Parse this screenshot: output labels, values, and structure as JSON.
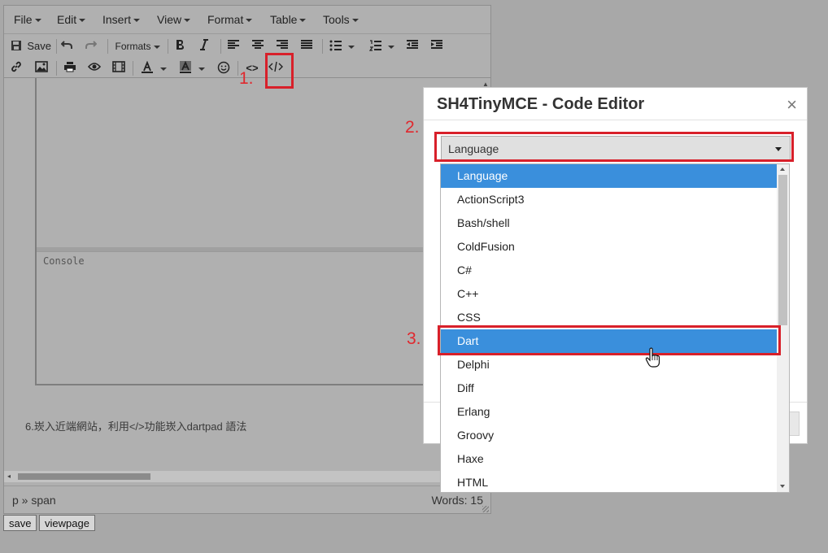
{
  "menubar": {
    "items": [
      {
        "label": "File"
      },
      {
        "label": "Edit"
      },
      {
        "label": "Insert"
      },
      {
        "label": "View"
      },
      {
        "label": "Format"
      },
      {
        "label": "Table"
      },
      {
        "label": "Tools"
      }
    ]
  },
  "toolbar": {
    "save_label": "Save",
    "formats_label": "Formats",
    "code_label": "<>",
    "icons": [
      "save-icon",
      "undo-icon",
      "redo-icon",
      "bold-icon",
      "italic-icon",
      "align-left-icon",
      "align-center-icon",
      "align-right-icon",
      "align-justify-icon",
      "bullet-list-icon",
      "numbered-list-icon",
      "outdent-icon",
      "indent-icon",
      "link-icon",
      "image-icon",
      "print-icon",
      "preview-icon",
      "media-icon",
      "text-color-icon",
      "background-color-icon",
      "emoticons-icon",
      "code-icon",
      "code-sample-icon"
    ]
  },
  "editor": {
    "console_label": "Console",
    "paragraph": "6.崁入近端網站，利用</>功能崁入dartpad 語法"
  },
  "statusbar": {
    "path": "p » span",
    "word_count": "Words: 15"
  },
  "bottom_buttons": {
    "save": "save",
    "viewpage": "viewpage"
  },
  "annotations": {
    "step1": "1.",
    "step2": "2.",
    "step3": "3.",
    "color": "#e0282e"
  },
  "dialog": {
    "title": "SH4TinyMCE - Code Editor",
    "close": "×",
    "select_value": "Language",
    "options": [
      {
        "label": "Language",
        "selected": true
      },
      {
        "label": "ActionScript3",
        "selected": false
      },
      {
        "label": "Bash/shell",
        "selected": false
      },
      {
        "label": "ColdFusion",
        "selected": false
      },
      {
        "label": "C#",
        "selected": false
      },
      {
        "label": "C++",
        "selected": false
      },
      {
        "label": "CSS",
        "selected": false
      },
      {
        "label": "Dart",
        "selected": true
      },
      {
        "label": "Delphi",
        "selected": false
      },
      {
        "label": "Diff",
        "selected": false
      },
      {
        "label": "Erlang",
        "selected": false
      },
      {
        "label": "Groovy",
        "selected": false
      },
      {
        "label": "Haxe",
        "selected": false
      },
      {
        "label": "HTML",
        "selected": false
      }
    ]
  },
  "colors": {
    "highlight": "#3a8fdc",
    "annotation_red": "#d8202a"
  }
}
